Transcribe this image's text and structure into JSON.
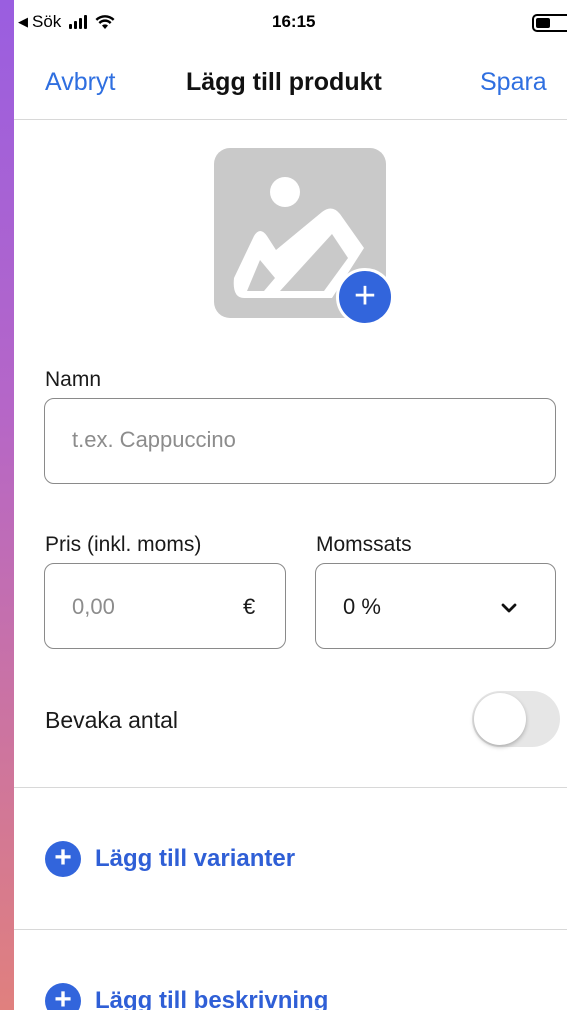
{
  "status_bar": {
    "back_label": "Sök",
    "time": "16:15"
  },
  "nav": {
    "cancel_label": "Avbryt",
    "title": "Lägg till produkt",
    "save_label": "Spara"
  },
  "form": {
    "name_label": "Namn",
    "name_placeholder": "t.ex. Cappuccino",
    "price_label": "Pris (inkl. moms)",
    "price_placeholder": "0,00",
    "currency_symbol": "€",
    "vat_label": "Momssats",
    "vat_value": "0 %",
    "track_quantity_label": "Bevaka antal",
    "track_quantity_enabled": false
  },
  "actions": {
    "add_variants_label": "Lägg till varianter",
    "add_description_label": "Lägg till beskrivning"
  },
  "colors": {
    "accent": "#2f6fe0",
    "add_button": "#3265dc",
    "image_placeholder": "#c9c9c9"
  },
  "icons": {
    "image_placeholder": "image-icon",
    "add_image": "plus-icon",
    "dropdown": "chevron-down-icon"
  }
}
